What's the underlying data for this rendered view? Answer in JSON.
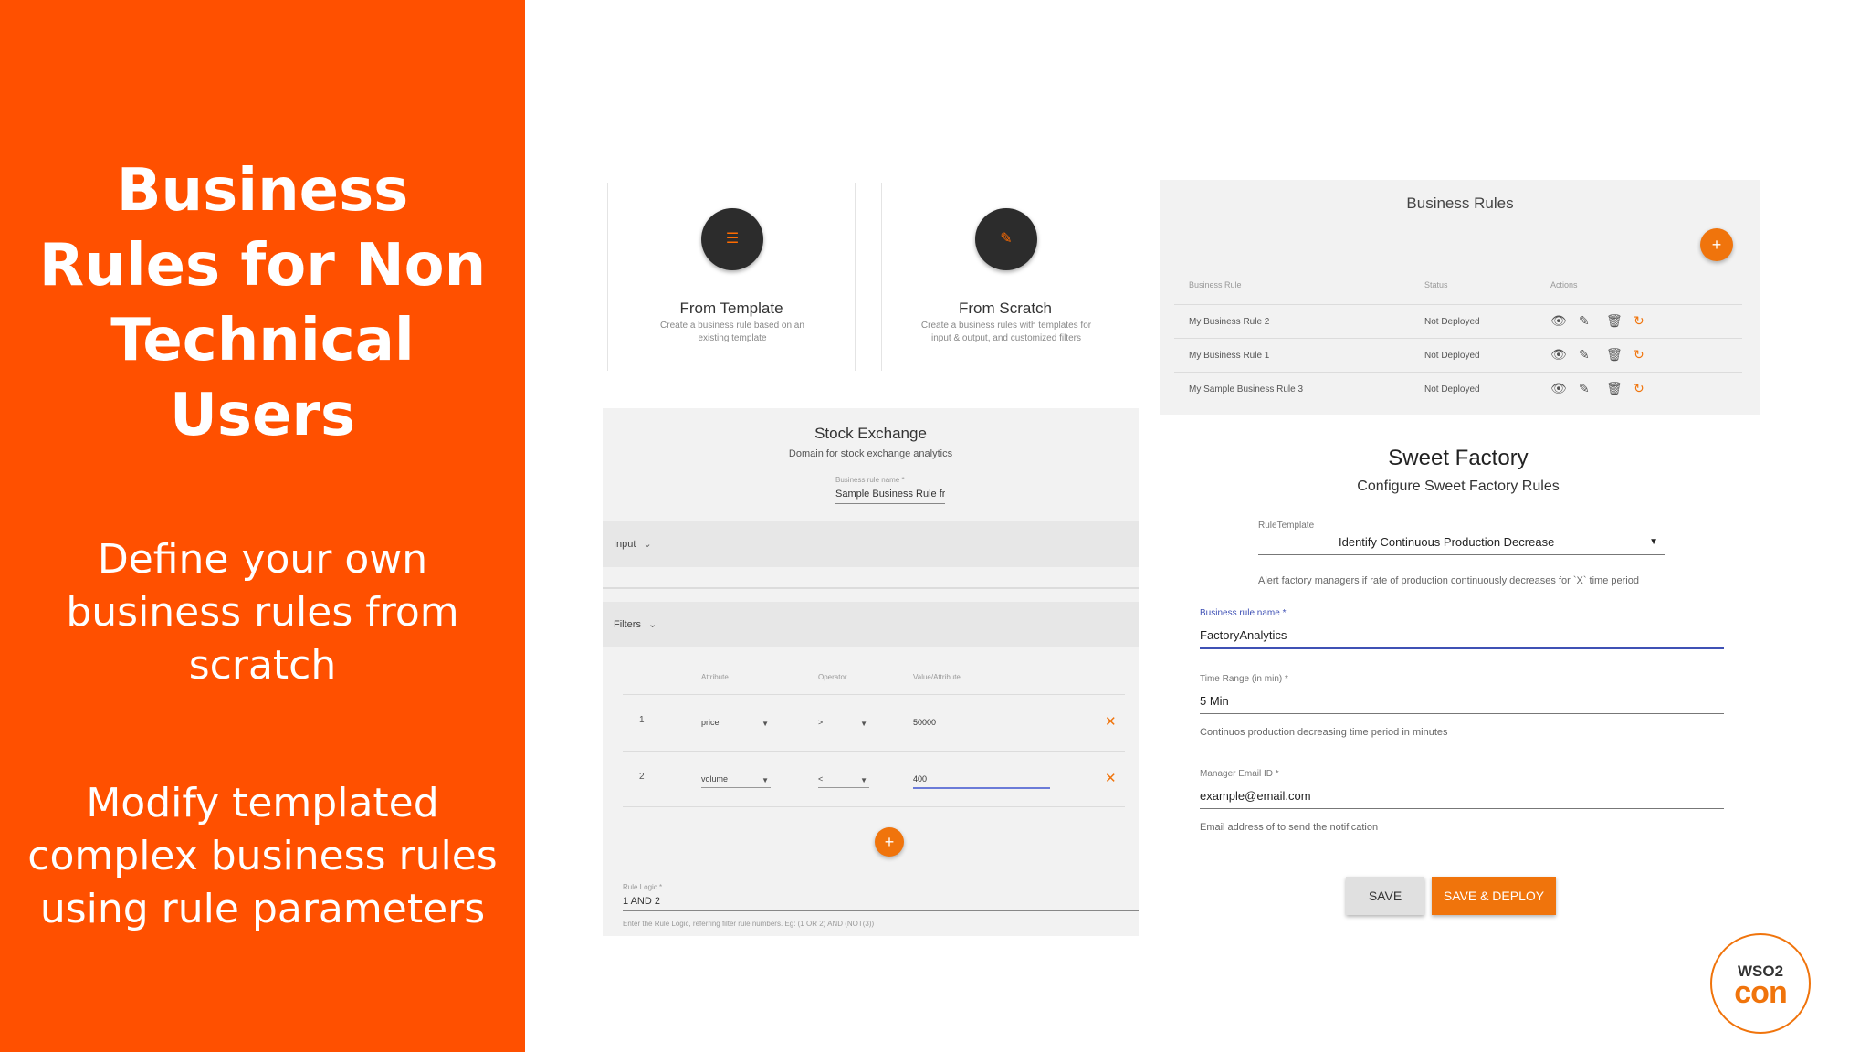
{
  "slide": {
    "title": "Business Rules for Non Technical Users",
    "subtitle_1": "Define your own business rules from scratch",
    "subtitle_2": "Modify templated complex business rules using rule parameters"
  },
  "create_cards": [
    {
      "icon": "list-icon",
      "title": "From Template",
      "description": "Create a business rule based on an existing template"
    },
    {
      "icon": "pencil-icon",
      "title": "From Scratch",
      "description": "Create a business rules with templates for input & output, and customized filters"
    }
  ],
  "business_rules": {
    "title": "Business Rules",
    "add_label": "+",
    "headers": {
      "name": "Business Rule",
      "status": "Status",
      "actions": "Actions"
    },
    "rows": [
      {
        "name": "My Business Rule 2",
        "status": "Not Deployed"
      },
      {
        "name": "My Business Rule 1",
        "status": "Not Deployed"
      },
      {
        "name": "My Sample Business Rule 3",
        "status": "Not Deployed"
      }
    ]
  },
  "stock_exchange": {
    "title": "Stock Exchange",
    "description": "Domain for stock exchange analytics",
    "name_label": "Business rule name *",
    "name_value": "Sample Business Rule from",
    "input_label": "Input",
    "filters_label": "Filters",
    "columns": {
      "attribute": "Attribute",
      "operator": "Operator",
      "value": "Value/Attribute"
    },
    "filters": [
      {
        "num": "1",
        "attribute": "price",
        "operator": ">",
        "value": "50000"
      },
      {
        "num": "2",
        "attribute": "volume",
        "operator": "<",
        "value": "400"
      }
    ],
    "add_label": "+",
    "remove_label": "✕",
    "rule_logic_label": "Rule Logic *",
    "rule_logic_value": "1 AND 2",
    "rule_logic_help": "Enter the Rule Logic, referring filter rule numbers. Eg: (1 OR 2) AND (NOT(3))"
  },
  "sweet_factory": {
    "title": "Sweet Factory",
    "subtitle": "Configure Sweet Factory Rules",
    "template_label": "RuleTemplate",
    "template_value": "Identify Continuous Production Decrease",
    "template_help": "Alert factory managers if rate of production continuously decreases for `X` time period",
    "name_label": "Business rule name *",
    "name_value": "FactoryAnalytics",
    "time_label": "Time Range (in min) *",
    "time_value": "5 Min",
    "time_help": "Continuos production decreasing time period in minutes",
    "email_label": "Manager Email ID *",
    "email_value": "example@email.com",
    "email_help": "Email address of to send the notification",
    "save_label": "SAVE",
    "deploy_label": "SAVE & DEPLOY"
  },
  "logo": {
    "top": "WSO2",
    "bottom": "con"
  },
  "colors": {
    "brand": "#ff5000",
    "accent": "#f0740c",
    "focus": "#3f51b5"
  }
}
